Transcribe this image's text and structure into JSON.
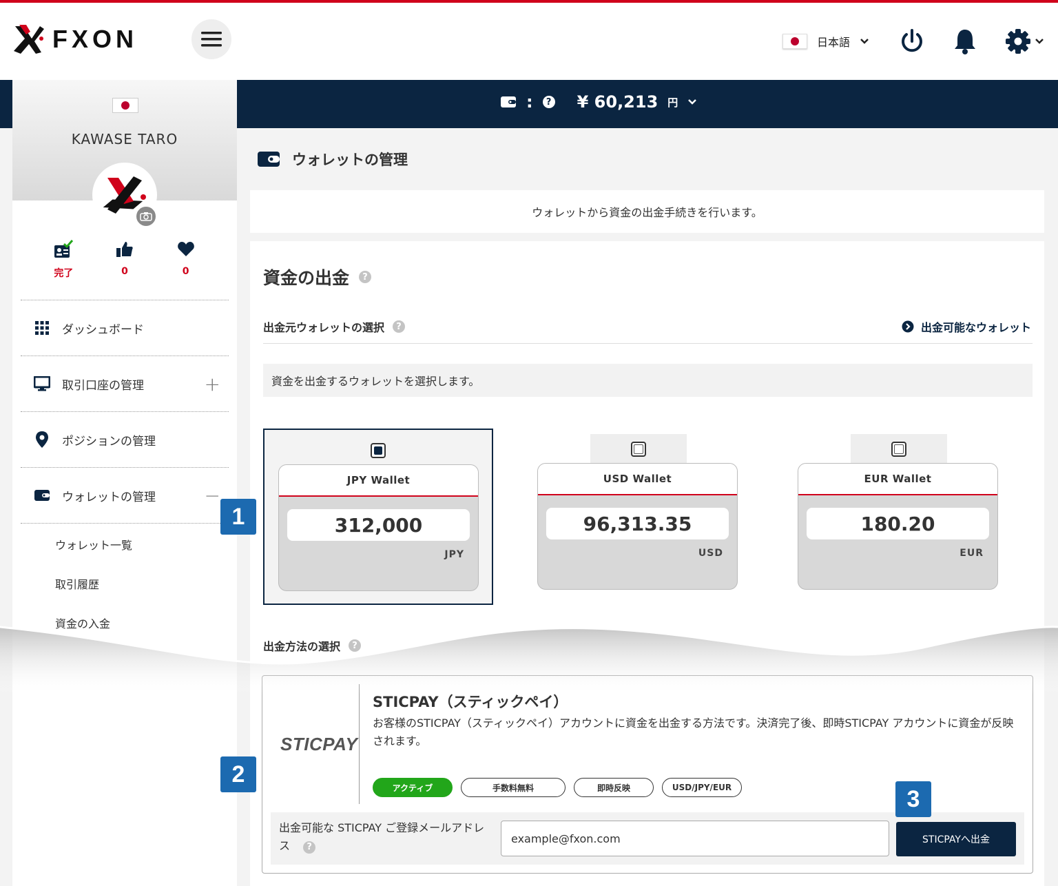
{
  "header": {
    "logo_text": "FXON",
    "language": "日本語"
  },
  "balance": {
    "separator": ":",
    "amount": "¥ 60,213",
    "unit": "円"
  },
  "profile": {
    "name": "KAWASE TARO",
    "stats": [
      {
        "icon": "id-card-check-icon",
        "value": "完了"
      },
      {
        "icon": "thumbs-up-icon",
        "value": "0"
      },
      {
        "icon": "heart-icon",
        "value": "0"
      }
    ]
  },
  "sidebar": {
    "items": [
      {
        "label": "ダッシュボード",
        "icon": "grid-icon"
      },
      {
        "label": "取引口座の管理",
        "icon": "monitor-icon",
        "toggle": "+"
      },
      {
        "label": "ポジションの管理",
        "icon": "map-pin-icon"
      },
      {
        "label": "ウォレットの管理",
        "icon": "wallet-icon",
        "toggle": "−"
      }
    ],
    "submenu": [
      "ウォレット一覧",
      "取引履歴",
      "資金の入金"
    ]
  },
  "page": {
    "title": "ウォレットの管理",
    "description": "ウォレットから資金の出金手続きを行います。"
  },
  "withdrawal": {
    "section_title": "資金の出金",
    "source_title": "出金元ウォレットの選択",
    "available_link": "出金可能なウォレット",
    "info": "資金を出金するウォレットを選択します。",
    "wallets": [
      {
        "name": "JPY Wallet",
        "amount": "312,000",
        "currency": "JPY",
        "selected": true
      },
      {
        "name": "USD Wallet",
        "amount": "96,313.35",
        "currency": "USD",
        "selected": false
      },
      {
        "name": "EUR Wallet",
        "amount": "180.20",
        "currency": "EUR",
        "selected": false
      }
    ],
    "method_title": "出金方法の選択",
    "method": {
      "logo": "STICPAY",
      "name": "STICPAY（スティックペイ）",
      "description": "お客様のSTICPAY（スティックペイ）アカウントに資金を出金する方法です。決済完了後、即時STICPAY アカウントに資金が反映されます。",
      "tags": [
        "アクティブ",
        "手数料無料",
        "即時反映",
        "USD/JPY/EUR"
      ],
      "email_label": "出金可能な STICPAY ご登録メールアドレス",
      "email_value": "example@fxon.com",
      "button": "STICPAYへ出金"
    }
  },
  "badges": [
    "1",
    "2",
    "3"
  ],
  "colors": {
    "navy": "#0b2541",
    "red": "#d0021b",
    "green": "#22a61a",
    "badge_blue": "#1c6ab0"
  }
}
